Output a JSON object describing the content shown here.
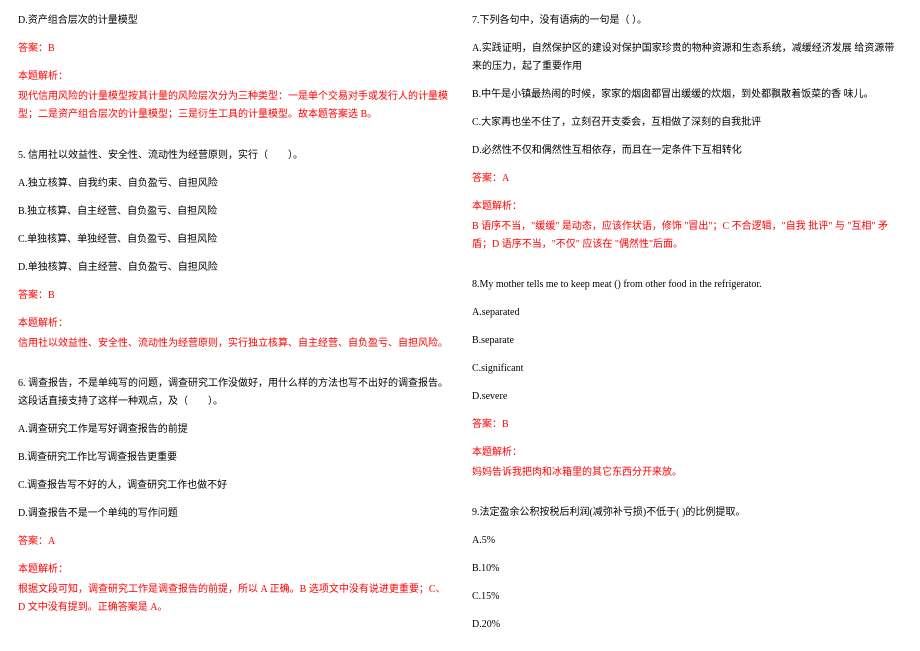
{
  "left": {
    "q4_optD": "D.资产组合层次的计量模型",
    "q4_answer": "答案：B",
    "q4_exp_title": "本题解析：",
    "q4_exp_body": "现代信用风险的计量模型按其计量的风险层次分为三种类型：一是单个交易对手或发行人的计量模型；二是资产组合层次的计量模型；三是衍生工具的计量模型。故本题答案选 B。",
    "q5_stem": "5. 信用社以效益性、安全性、流动性为经营原则，实行（　　）。",
    "q5_a": "A.独立核算、自我约束、自负盈亏、自担风险",
    "q5_b": "B.独立核算、自主经营、自负盈亏、自担风险",
    "q5_c": "C.单独核算、单独经营、自负盈亏、自担风险",
    "q5_d": "D.单独核算、自主经营、自负盈亏、自担风险",
    "q5_answer": "答案：B",
    "q5_exp_title": "本题解析：",
    "q5_exp_body": "信用社以效益性、安全性、流动性为经营原则，实行独立核算、自主经营、自负盈亏、自担风险。",
    "q6_stem": "6. 调查报告，不是单纯写的问题，调查研究工作没做好，用什么样的方法也写不出好的调查报告。这段话直接支持了这样一种观点，及（　　）。",
    "q6_a": "A.调查研究工作是写好调查报告的前提",
    "q6_b": "B.调查研究工作比写调查报告更重要",
    "q6_c": "C.调查报告写不好的人，调查研究工作也做不好",
    "q6_d": "D.调查报告不是一个单纯的写作问题",
    "q6_answer": "答案：A",
    "q6_exp_title": "本题解析：",
    "q6_exp_body": "根据文段可知，调查研究工作是调查报告的前提，所以 A 正确。B 选项文中没有说进更重要；C、D 文中没有提到。正确答案是 A。"
  },
  "right": {
    "q7_stem": "7.下列各句中，没有语病的一句是（ ）。",
    "q7_a": "A.实践证明，自然保护区的建设对保护国家珍贵的物种资源和生态系统，减缓经济发展  给资源带来的压力，起了重要作用",
    "q7_b": "B.中午是小镇最热闹的时候，家家的烟囱都冒出缓缓的炊烟，到处都飘散着饭菜的香  味儿。",
    "q7_c": "C.大家再也坐不住了，立刻召开支委会，互相做了深刻的自我批评",
    "q7_d": "D.必然性不仅和偶然性互相依存，而且在一定条件下互相转化",
    "q7_answer": "答案：A",
    "q7_exp_title": "本题解析：",
    "q7_exp_body": "B 语序不当，\"缓缓\" 是动态，应该作状语，修饰 \"冒出\"；C 不合逻辑，\"自我  批评\" 与 \"互相\" 矛盾；D 语序不当，\"不仅\" 应该在 \"偶然性\"后面。",
    "q8_stem": "8.My mother tells me to keep meat () from other food in the refrigerator.",
    "q8_a": "A.separated",
    "q8_b": "B.separate",
    "q8_c": "C.significant",
    "q8_d": "D.severe",
    "q8_answer": "答案：B",
    "q8_exp_title": "本题解析：",
    "q8_exp_body": "妈妈告诉我把肉和冰箱里的其它东西分开来放。",
    "q9_stem": "9.法定盈余公积按税后利润(减弥补亏损)不低于( )的比例提取。",
    "q9_a": "A.5%",
    "q9_b": "B.10%",
    "q9_c": "C.15%",
    "q9_d": "D.20%"
  }
}
